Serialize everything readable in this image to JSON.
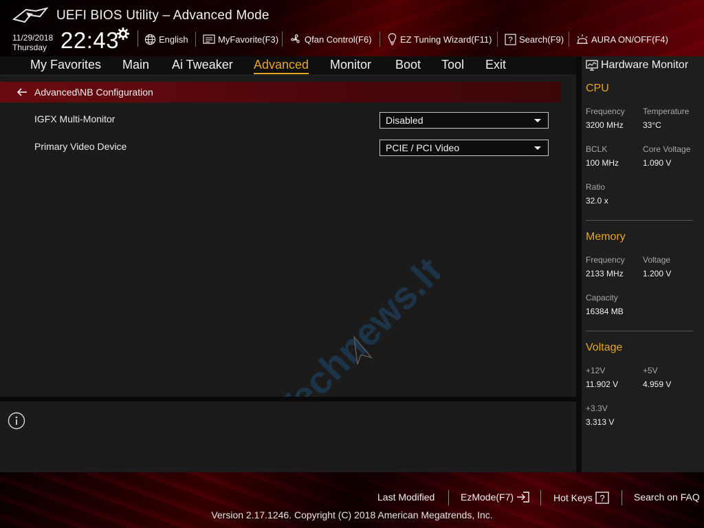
{
  "header": {
    "title": "UEFI BIOS Utility – Advanced Mode",
    "date": "11/29/2018",
    "day": "Thursday",
    "time": "22:43",
    "toolbar": {
      "language": "English",
      "my_favorite": "MyFavorite(F3)",
      "qfan_control": "Qfan Control(F6)",
      "ez_tuning": "EZ Tuning Wizard(F11)",
      "search": "Search(F9)",
      "aura": "AURA ON/OFF(F4)"
    }
  },
  "nav": {
    "tabs": [
      {
        "label": "My Favorites"
      },
      {
        "label": "Main"
      },
      {
        "label": "Ai Tweaker"
      },
      {
        "label": "Advanced"
      },
      {
        "label": "Monitor"
      },
      {
        "label": "Boot"
      },
      {
        "label": "Tool"
      },
      {
        "label": "Exit"
      }
    ],
    "active": "Advanced"
  },
  "main": {
    "breadcrumb": "Advanced\\NB Configuration",
    "settings": [
      {
        "label": "IGFX Multi-Monitor",
        "value": "Disabled"
      },
      {
        "label": "Primary Video Device",
        "value": "PCIE / PCI Video"
      }
    ]
  },
  "hardware_monitor": {
    "title": "Hardware Monitor",
    "cpu": {
      "heading": "CPU",
      "frequency_label": "Frequency",
      "frequency": "3200 MHz",
      "temperature_label": "Temperature",
      "temperature": "33°C",
      "bclk_label": "BCLK",
      "bclk": "100 MHz",
      "core_voltage_label": "Core Voltage",
      "core_voltage": "1.090 V",
      "ratio_label": "Ratio",
      "ratio": "32.0 x"
    },
    "memory": {
      "heading": "Memory",
      "frequency_label": "Frequency",
      "frequency": "2133 MHz",
      "voltage_label": "Voltage",
      "voltage": "1.200 V",
      "capacity_label": "Capacity",
      "capacity": "16384 MB"
    },
    "voltage": {
      "heading": "Voltage",
      "v12_label": "+12V",
      "v12": "11.902 V",
      "v5_label": "+5V",
      "v5": "4.959 V",
      "v33_label": "+3.3V",
      "v33": "3.313 V"
    }
  },
  "footer": {
    "last_modified": "Last Modified",
    "ezmode": "EzMode(F7)",
    "hot_keys": "Hot Keys",
    "search_faq": "Search on FAQ",
    "version": "Version 2.17.1246. Copyright (C) 2018 American Megatrends, Inc."
  },
  "watermark": "Technews.lt",
  "colors": {
    "accent": "#e8a523",
    "breadcrumb_bg": "#6b0a10",
    "panel_bg": "#1b1b1b",
    "monitor_bg": "#1e1e1e"
  }
}
